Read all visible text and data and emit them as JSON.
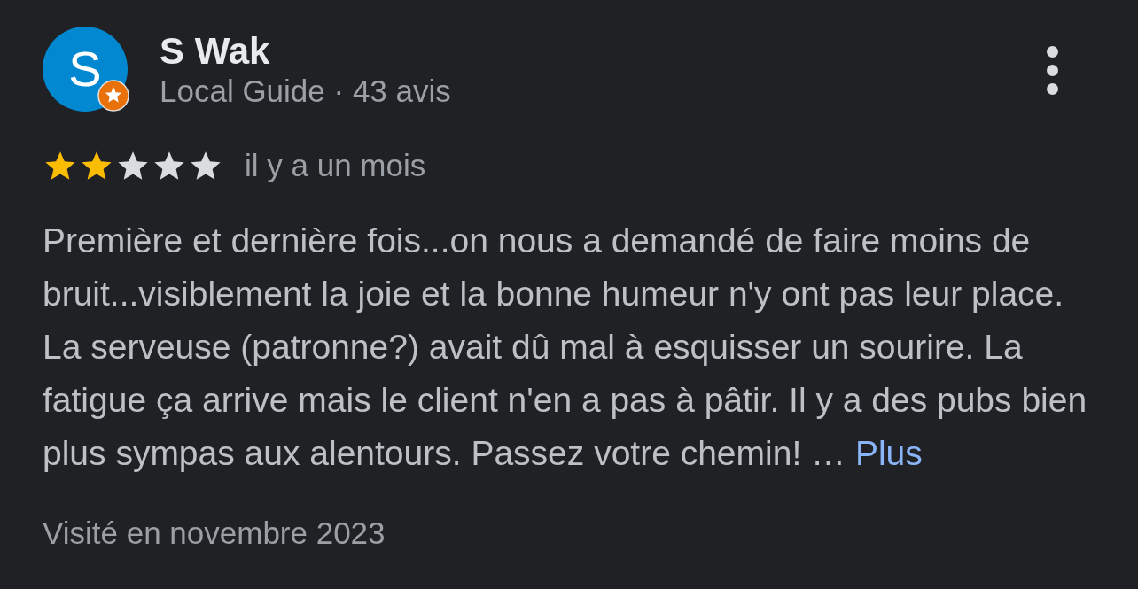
{
  "review": {
    "author": {
      "initial": "S",
      "name": "S Wak",
      "local_guide": true,
      "subtitle": "Local Guide · 43 avis"
    },
    "stars": 2,
    "time": "il y a un mois",
    "text": "Première et dernière fois...on nous a demandé de faire moins de bruit...visiblement la joie et la bonne humeur n'y ont pas leur place. La serveuse (patronne?) avait dû mal à esquisser un sourire. La fatigue ça arrive mais le client n'en a pas à pâtir. Il y a des pubs bien plus sympas aux alentours. Passez votre chemin! …",
    "more_link": "Plus",
    "visit": "Visité en novembre 2023"
  }
}
